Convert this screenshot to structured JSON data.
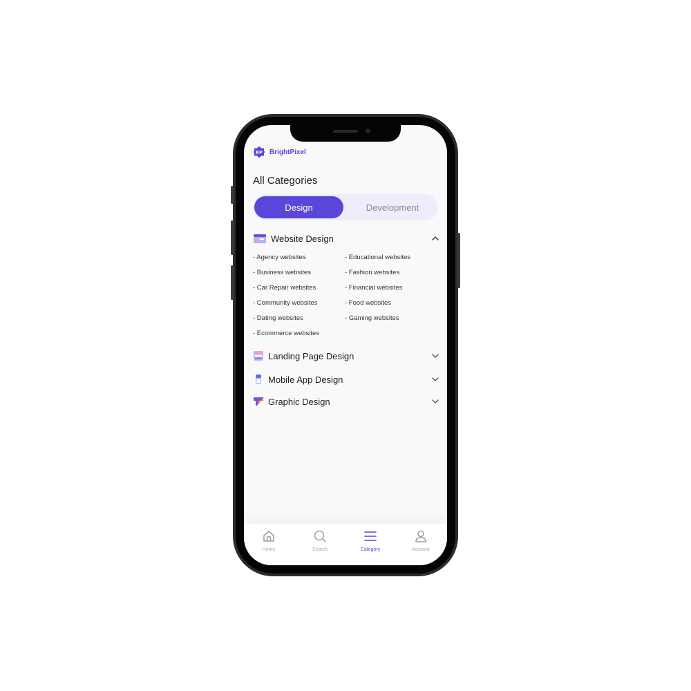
{
  "app": {
    "brand": "BrightPixel",
    "logo_text": "BP",
    "accent": "#5a46d8"
  },
  "page": {
    "title": "All Categories"
  },
  "tabs": [
    {
      "label": "Design",
      "active": true
    },
    {
      "label": "Development",
      "active": false
    }
  ],
  "categories": [
    {
      "label": "Website Design",
      "icon": "browser-window-icon",
      "expanded": true,
      "subcategories": [
        "- Agency websites",
        "- Business websites",
        "- Car Repair websites",
        "- Community websites",
        "- Dating websites",
        "- Ecommerce websites",
        "- Educational websites",
        "- Fashion websites",
        "- Financial websites",
        "- Food websites",
        "- Gaming websites"
      ]
    },
    {
      "label": "Landing Page Design",
      "icon": "landing-page-icon",
      "expanded": false
    },
    {
      "label": "Mobile App Design",
      "icon": "mobile-app-icon",
      "expanded": false
    },
    {
      "label": "Graphic Design",
      "icon": "graphic-design-icon",
      "expanded": false
    }
  ],
  "bottom_nav": [
    {
      "label": "Home",
      "icon": "home-icon",
      "active": false
    },
    {
      "label": "Search",
      "icon": "search-icon",
      "active": false
    },
    {
      "label": "Category",
      "icon": "menu-icon",
      "active": true
    },
    {
      "label": "Account",
      "icon": "user-icon",
      "active": false
    }
  ]
}
